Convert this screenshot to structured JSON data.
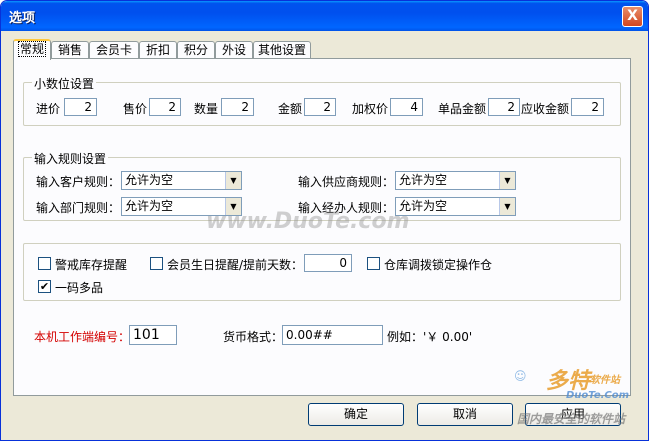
{
  "window": {
    "title": "选项",
    "close_label": "X"
  },
  "tabs": [
    {
      "label": "常规",
      "active": true
    },
    {
      "label": "销售"
    },
    {
      "label": "会员卡"
    },
    {
      "label": "折扣"
    },
    {
      "label": "积分"
    },
    {
      "label": "外设"
    },
    {
      "label": "其他设置"
    }
  ],
  "decimals": {
    "title": "小数位设置",
    "fields": [
      {
        "label": "进价",
        "value": "2"
      },
      {
        "label": "售价",
        "value": "2"
      },
      {
        "label": "数量",
        "value": "2"
      },
      {
        "label": "金额",
        "value": "2"
      },
      {
        "label": "加权价",
        "value": "4"
      },
      {
        "label": "单品金额",
        "value": "2"
      },
      {
        "label": "应收金额",
        "value": "2"
      }
    ]
  },
  "rules": {
    "title": "输入规则设置",
    "customer": {
      "label": "输入客户规则：",
      "value": "允许为空"
    },
    "supplier": {
      "label": "输入供应商规则：",
      "value": "允许为空"
    },
    "department": {
      "label": "输入部门规则：",
      "value": "允许为空"
    },
    "agent": {
      "label": "输入经办人规则：",
      "value": "允许为空"
    }
  },
  "options": {
    "stock_alert": {
      "label": "警戒库存提醒",
      "checked": false
    },
    "birthday": {
      "label": "会员生日提醒/提前天数：",
      "checked": false,
      "days": "0"
    },
    "warehouse_lock": {
      "label": "仓库调拨锁定操作仓",
      "checked": false
    },
    "one_code_multi": {
      "label": "一码多品",
      "checked": true,
      "mark": "✔"
    }
  },
  "terminal": {
    "label": "本机工作端编号：",
    "value": "101"
  },
  "currency": {
    "label": "货币格式：",
    "value": "0.00##",
    "example": "例如：'￥ 0.00'"
  },
  "buttons": {
    "ok": "确定",
    "cancel": "取消",
    "apply": "应用"
  },
  "watermarks": {
    "center": "www.DuoTe.com",
    "brand": "多特",
    "brand_sub": "软件站",
    "site": "DuoTe.Com",
    "slogan": "国内最安全的软件站"
  }
}
